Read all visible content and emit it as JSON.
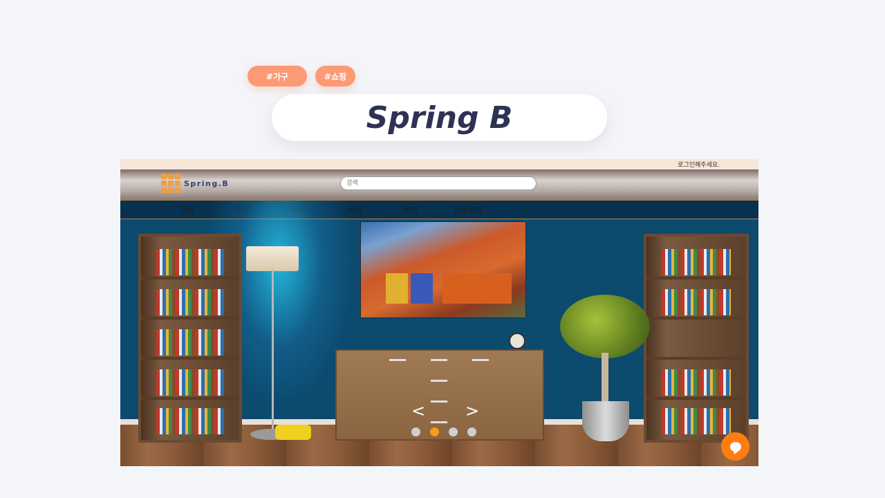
{
  "tags": [
    "#가구",
    "#쇼핑"
  ],
  "hero": {
    "title": "Spring B"
  },
  "site": {
    "login_notice": "로그인해주세요.",
    "logo_text": "Spring.B",
    "search_placeholder": "검색",
    "nav": [
      "거실",
      "주방",
      "침실",
      "서재",
      "잡화",
      "전체보기"
    ]
  },
  "slider": {
    "prev_label": "<",
    "next_label": ">",
    "slide_count": 4,
    "active_slide": 2
  },
  "colors": {
    "accent": "#fb9a74",
    "title": "#2e3356",
    "active_dot": "#f59c1a",
    "chat_button": "#ff7d0f"
  },
  "icons": [
    "logo-icon",
    "chat-icon"
  ]
}
